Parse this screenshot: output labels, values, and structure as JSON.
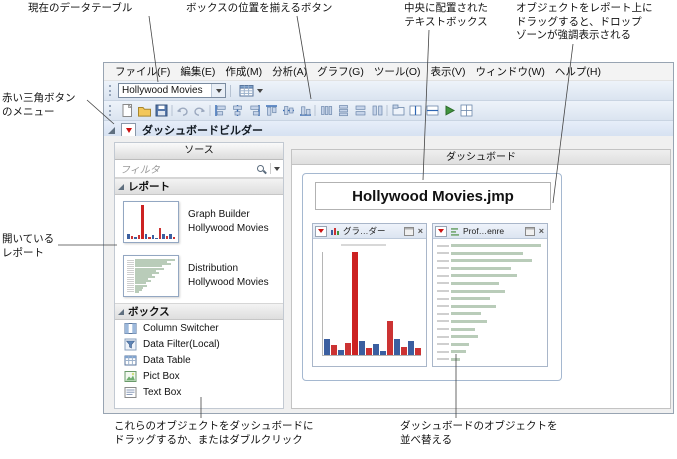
{
  "annotations": {
    "current_data_table": "現在のデータテーブル",
    "align_boxes_button": "ボックスの位置を揃えるボタン",
    "centered_text_box": "中央に配置された\nテキストボックス",
    "drop_zone": "オブジェクトをレポート上に\nドラッグすると、ドロップ\nゾーンが強調表示される",
    "red_triangle_menu": "赤い三角ボタン\nのメニュー",
    "open_reports": "開いている\nレポート",
    "drag_objects": "これらのオブジェクトをダッシュボードに\nドラッグするか、またはダブルクリック",
    "rearrange_objects": "ダッシュボードのオブジェクトを\n並べ替える"
  },
  "menubar": {
    "items": [
      "ファイル(F)",
      "編集(E)",
      "作成(M)",
      "分析(A)",
      "グラフ(G)",
      "ツール(O)",
      "表示(V)",
      "ウィンドウ(W)",
      "ヘルプ(H)"
    ]
  },
  "toolbar": {
    "data_table_combo": "Hollywood Movies",
    "icon_names": [
      "new",
      "open",
      "save",
      "undo",
      "redo",
      "align-left",
      "align-center",
      "align-right",
      "align-top",
      "align-middle",
      "align-bottom",
      "distribute-horizontal",
      "distribute-vertical",
      "make-same-width",
      "make-same-height",
      "tab-box",
      "splitter-horizontal",
      "splitter-vertical",
      "run",
      "layout-grid"
    ]
  },
  "builder": {
    "title": "ダッシュボードビルダー"
  },
  "source_panel": {
    "title": "ソース",
    "filter_placeholder": "フィルタ",
    "reports_header": "レポート",
    "reports": [
      {
        "line1": "Graph Builder",
        "line2": "Hollywood Movies"
      },
      {
        "line1": "Distribution",
        "line2": "Hollywood Movies"
      }
    ],
    "boxes_header": "ボックス",
    "boxes": [
      "Column Switcher",
      "Data Filter(Local)",
      "Data Table",
      "Pict Box",
      "Text Box"
    ]
  },
  "dashboard": {
    "header": "ダッシュボード",
    "title_box": "Hollywood Movies.jmp",
    "panels": [
      {
        "title": "グラ…ダー"
      },
      {
        "title": "Prof…enre"
      }
    ]
  },
  "glyphs": {
    "close": "×"
  },
  "colors": {
    "accent_blue": "#2f66b3",
    "bar_blue": "#3b5fa0",
    "bar_red": "#cc2222",
    "bar_green": "#b9ccb9",
    "toolbar_bg": "#dbe4f0",
    "red_triangle": "#cc1111"
  },
  "chart_data": [
    {
      "type": "bar",
      "title": "",
      "values": [
        12,
        7,
        4,
        9,
        75,
        10,
        5,
        8,
        3,
        25,
        12,
        6,
        10,
        5
      ],
      "colors": [
        "#3b5fa0",
        "#cc3333",
        "#3b5fa0",
        "#cc3333",
        "#cc2222",
        "#3b5fa0",
        "#cc3333",
        "#3b5fa0",
        "#3b5fa0",
        "#cc3333",
        "#3b5fa0",
        "#cc3333",
        "#3b5fa0",
        "#cc3333"
      ]
    },
    {
      "type": "hbar",
      "title": "",
      "values": [
        30,
        24,
        27,
        20,
        22,
        16,
        18,
        13,
        15,
        10,
        12,
        8,
        9,
        6,
        5,
        3
      ],
      "color": "#b9ccb9"
    }
  ]
}
